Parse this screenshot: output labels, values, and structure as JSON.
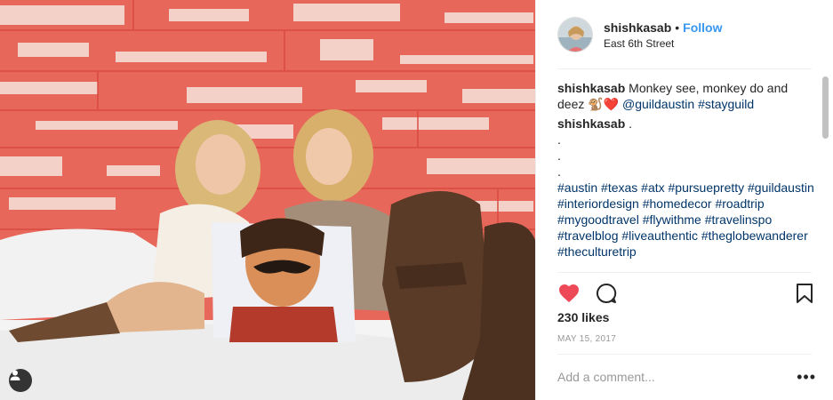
{
  "post": {
    "username": "shishkasab",
    "separator": "•",
    "follow_label": "Follow",
    "location": "East 6th Street",
    "caption": {
      "user": "shishkasab",
      "text": "Monkey see, monkey do and deez",
      "emoji": "🐒❤️",
      "mention": "@guildaustin",
      "hashtag": "#stayguild"
    },
    "comment2": {
      "user": "shishkasab",
      "text": ".",
      "dots": [
        ".",
        ".",
        "."
      ],
      "hashtags": "#austin #texas #atx #pursuepretty #guildaustin #interiordesign #homedecor #roadtrip #mygoodtravel #flywithme #travelinspo #travelblog #liveauthentic #theglobewanderer #theculturetrip"
    },
    "likes": "230 likes",
    "date": "MAY 15, 2017",
    "comment_placeholder": "Add a comment...",
    "more_label": "•••",
    "icons": {
      "like": "heart-icon",
      "comment": "comment-bubble-icon",
      "save": "bookmark-icon",
      "tag": "user-tag-icon"
    },
    "colors": {
      "like_red": "#ed4956",
      "link_blue": "#003569",
      "follow_blue": "#3897f0"
    }
  }
}
